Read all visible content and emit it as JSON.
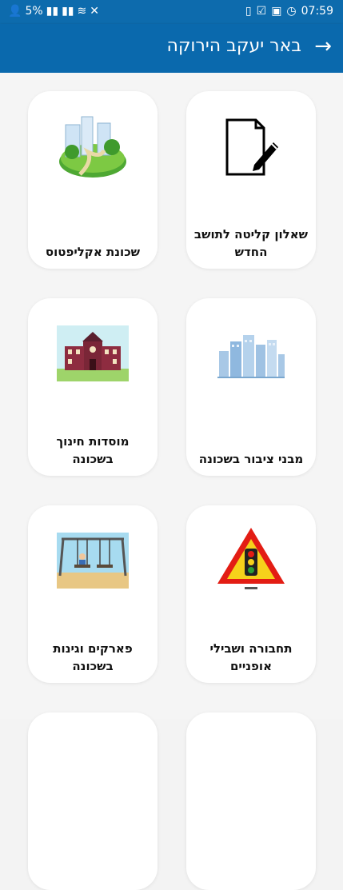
{
  "status": {
    "battery": "5%",
    "time": "07:59"
  },
  "appbar": {
    "title": "באר יעקב הירוקה",
    "back_icon": "arrow-right-icon"
  },
  "cards": [
    {
      "label": "שאלון קליטה לתושב החדש",
      "icon": "document-edit-icon"
    },
    {
      "label": "שכונת אקליפטוס",
      "icon": "neighborhood-illustration-icon"
    },
    {
      "label": "מבני ציבור בשכונה",
      "icon": "city-buildings-icon"
    },
    {
      "label": "מוסדות חינוך בשכונה",
      "icon": "school-icon"
    },
    {
      "label": "תחבורה ושבילי אופניים",
      "icon": "traffic-light-sign-icon"
    },
    {
      "label": "פארקים וגינות בשכונה",
      "icon": "playground-swing-icon"
    }
  ]
}
